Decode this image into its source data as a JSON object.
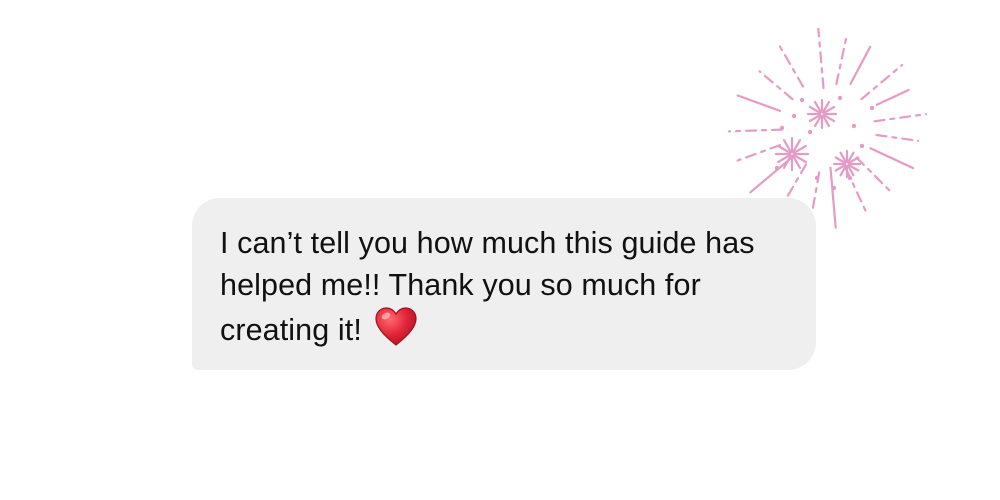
{
  "message": {
    "text": "I can’t tell you how much this guide has helped me!! Thank you so much for creating it!",
    "emoji_icon": "red-heart-icon"
  },
  "decoration": {
    "icon": "firework-sparkle-icon",
    "color": "#e49bc5"
  },
  "colors": {
    "background": "#ffffff",
    "bubble": "#efefef",
    "text": "#111111",
    "heart": "#e2263a"
  }
}
